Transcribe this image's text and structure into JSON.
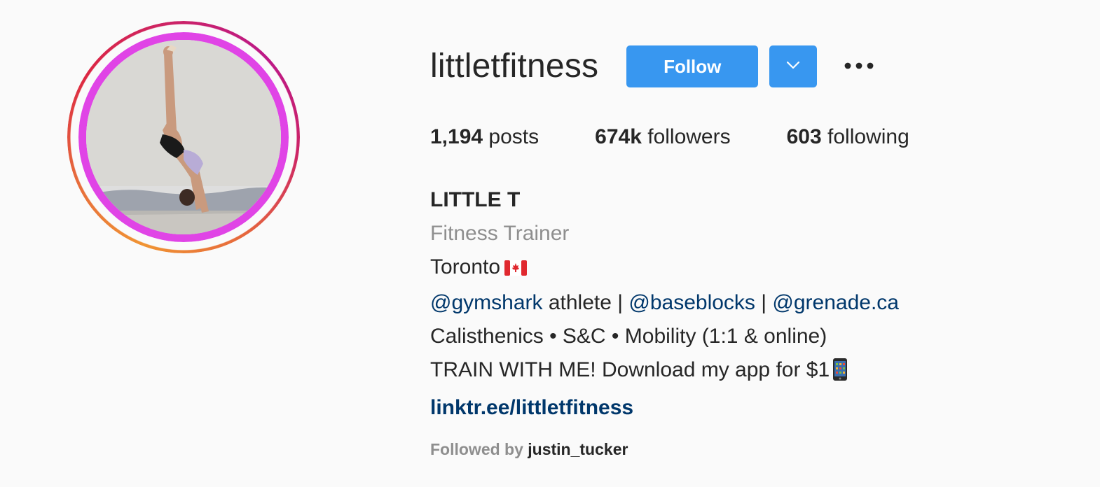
{
  "profile": {
    "username": "littletfitness",
    "follow_label": "Follow",
    "stats": {
      "posts_count": "1,194",
      "posts_label": "posts",
      "followers_count": "674k",
      "followers_label": "followers",
      "following_count": "603",
      "following_label": "following"
    },
    "bio": {
      "full_name": "LITTLE T",
      "category": "Fitness Trainer",
      "location": "Toronto",
      "mention_1": "@gymshark",
      "text_athlete": " athlete | ",
      "mention_2": "@baseblocks",
      "separator": " | ",
      "mention_3": "@grenade.ca",
      "line_disciplines": "Calisthenics • S&C • Mobility (1:1 & online)",
      "line_train": "TRAIN WITH ME! Download my app for $1",
      "link": "linktr.ee/littletfitness"
    },
    "followed_by_label": "Followed by",
    "followed_by_user": "justin_tucker"
  },
  "icons": {
    "dropdown": "chevron-down-icon",
    "more": "more-options-icon",
    "flag": "canada-flag-icon",
    "phone": "mobile-phone-icon"
  },
  "colors": {
    "accent": "#3897f0",
    "link": "#00376b",
    "muted": "#8e8e8e",
    "text": "#262626",
    "background": "#fafafa"
  }
}
